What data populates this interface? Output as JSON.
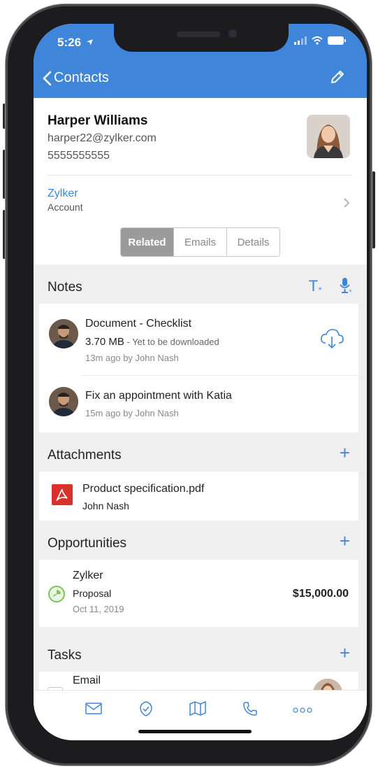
{
  "status": {
    "time": "5:26"
  },
  "nav": {
    "back_label": "Contacts"
  },
  "contact": {
    "name": "Harper Williams",
    "email": "harper22@zylker.com",
    "phone": "5555555555",
    "account_name": "Zylker",
    "account_label": "Account"
  },
  "segments": [
    {
      "label": "Related",
      "active": true
    },
    {
      "label": "Emails",
      "active": false
    },
    {
      "label": "Details",
      "active": false
    }
  ],
  "notes": {
    "title": "Notes",
    "text_note_icon_label": "T",
    "items": [
      {
        "title": "Document - Checklist",
        "size": "3.70 MB",
        "status": " - Yet to be downloaded",
        "meta": "13m ago by John Nash"
      },
      {
        "title": "Fix an appointment with Katia",
        "meta": "15m ago by John Nash"
      }
    ]
  },
  "attachments": {
    "title": "Attachments",
    "items": [
      {
        "name": "Product specification.pdf",
        "owner": "John Nash"
      }
    ]
  },
  "opportunities": {
    "title": "Opportunities",
    "items": [
      {
        "name": "Zylker",
        "stage": "Proposal",
        "date": "Oct 11, 2019",
        "amount": "$15,000.00"
      }
    ]
  },
  "tasks": {
    "title": "Tasks",
    "items": [
      {
        "title": "Email"
      }
    ]
  },
  "tabbar": {
    "items": [
      "mail",
      "check",
      "map",
      "phone",
      "more"
    ]
  },
  "colors": {
    "accent": "#3f85da",
    "pdf_red": "#d9322a",
    "stage_green": "#7ac35b"
  }
}
